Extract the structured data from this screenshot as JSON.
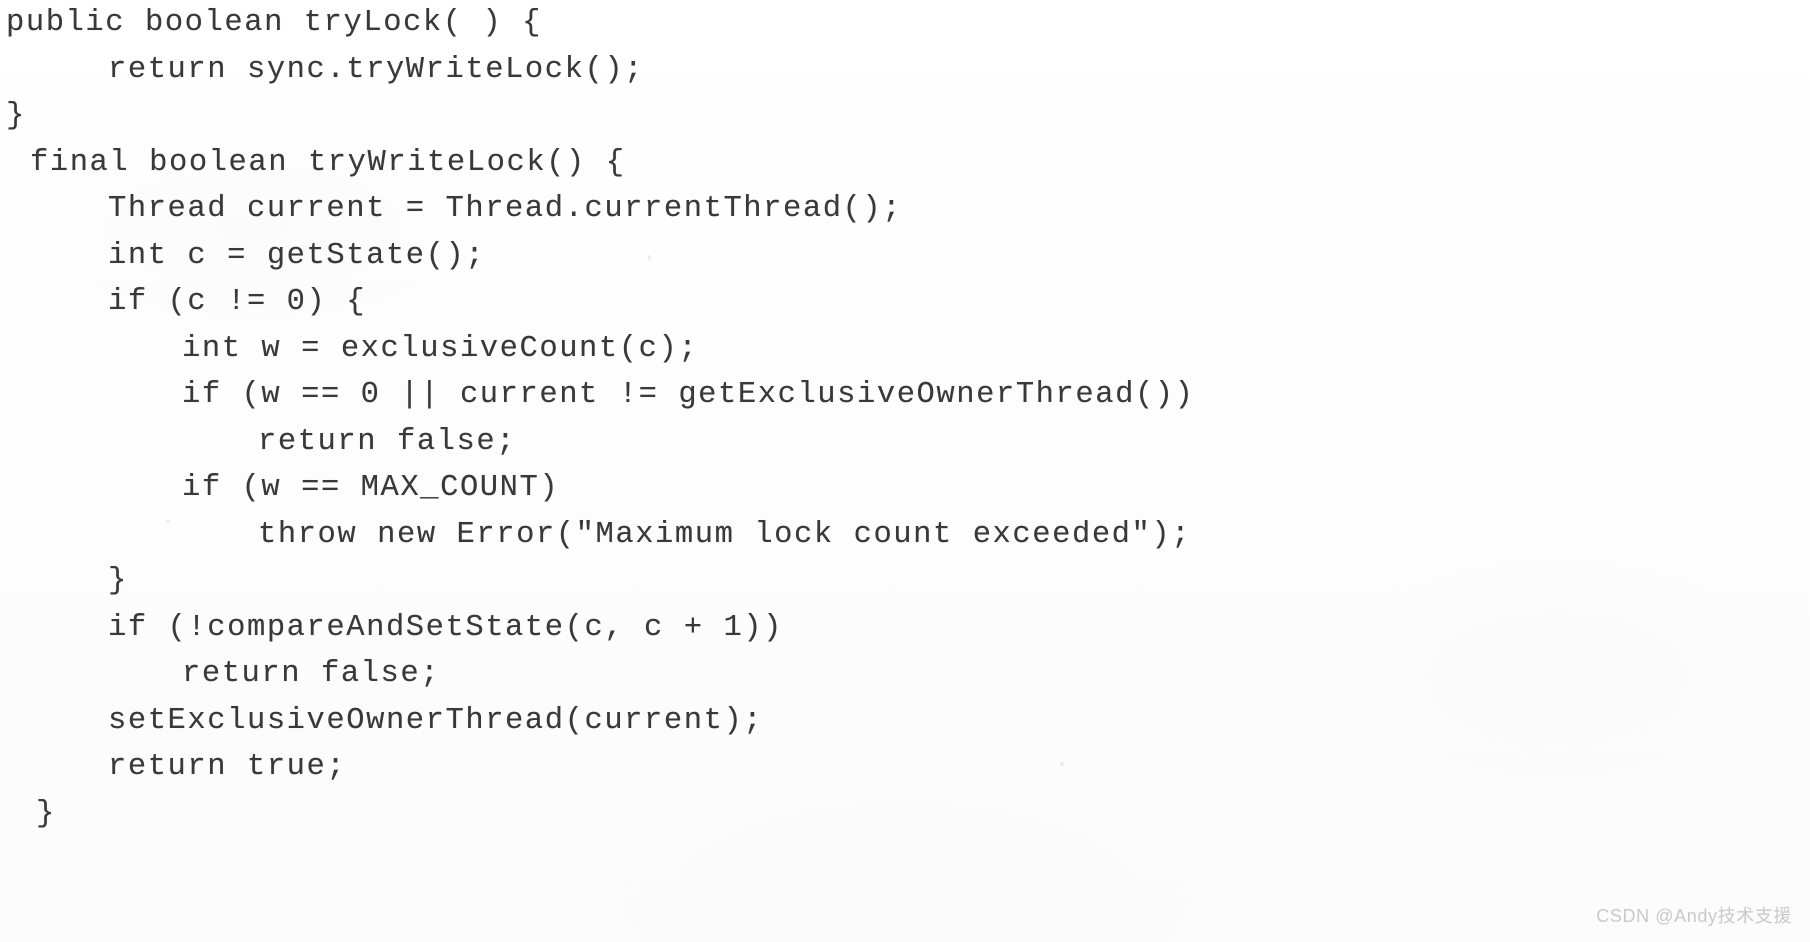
{
  "document": {
    "kind": "scanned-book-page",
    "language": "Java",
    "background_color": "#fefefe",
    "text_color": "#2b2b2b"
  },
  "code": {
    "lines": [
      {
        "text": "public boolean tryLock( ) {",
        "indent": "ind0"
      },
      {
        "text": "return sync.tryWriteLock();",
        "indent": "ind1"
      },
      {
        "text": "}",
        "indent": "ind0"
      },
      {
        "text": "final boolean tryWriteLock() {",
        "indent": "ind-h"
      },
      {
        "text": "Thread current = Thread.currentThread();",
        "indent": "ind1"
      },
      {
        "text": "int c = getState();",
        "indent": "ind1"
      },
      {
        "text": "if (c != 0) {",
        "indent": "ind1"
      },
      {
        "text": "int w = exclusiveCount(c);",
        "indent": "ind2"
      },
      {
        "text": "if (w == 0 || current != getExclusiveOwnerThread())",
        "indent": "ind2"
      },
      {
        "text": "return false;",
        "indent": "ind3"
      },
      {
        "text": "if (w == MAX_COUNT)",
        "indent": "ind2"
      },
      {
        "text": "throw new Error(\"Maximum lock count exceeded\");",
        "indent": "ind3"
      },
      {
        "text": "}",
        "indent": "ind1"
      },
      {
        "text": "if (!compareAndSetState(c, c + 1))",
        "indent": "ind1"
      },
      {
        "text": "return false;",
        "indent": "ind2"
      },
      {
        "text": "setExclusiveOwnerThread(current);",
        "indent": "ind1"
      },
      {
        "text": "return true;",
        "indent": "ind1"
      },
      {
        "text": "}",
        "indent": "ind-b"
      }
    ]
  },
  "watermark": {
    "text": "CSDN @Andy技术支援",
    "color": "#c9c9c9"
  }
}
